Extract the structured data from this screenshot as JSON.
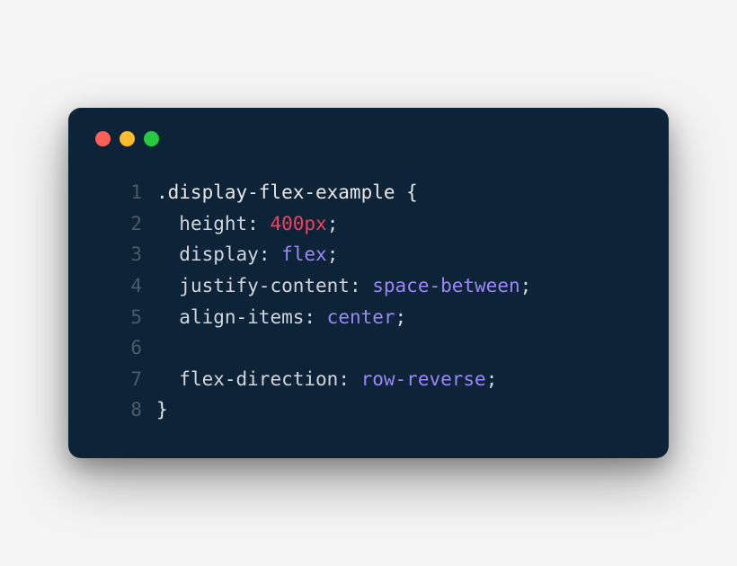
{
  "window": {
    "traffic_lights": [
      "red",
      "yellow",
      "green"
    ]
  },
  "code": {
    "lines": [
      {
        "n": "1",
        "indent": 0,
        "tokens": [
          {
            "t": ".display-flex-example ",
            "c": "tok-selector"
          },
          {
            "t": "{",
            "c": "tok-brace"
          }
        ]
      },
      {
        "n": "2",
        "indent": 2,
        "tokens": [
          {
            "t": "height",
            "c": "tok-prop"
          },
          {
            "t": ": ",
            "c": "tok-punct"
          },
          {
            "t": "400",
            "c": "tok-number"
          },
          {
            "t": "px",
            "c": "tok-unit"
          },
          {
            "t": ";",
            "c": "tok-punct"
          }
        ]
      },
      {
        "n": "3",
        "indent": 2,
        "tokens": [
          {
            "t": "display",
            "c": "tok-prop"
          },
          {
            "t": ": ",
            "c": "tok-punct"
          },
          {
            "t": "flex",
            "c": "tok-value"
          },
          {
            "t": ";",
            "c": "tok-punct"
          }
        ]
      },
      {
        "n": "4",
        "indent": 2,
        "tokens": [
          {
            "t": "justify-content",
            "c": "tok-prop"
          },
          {
            "t": ": ",
            "c": "tok-punct"
          },
          {
            "t": "space-between",
            "c": "tok-value"
          },
          {
            "t": ";",
            "c": "tok-punct"
          }
        ]
      },
      {
        "n": "5",
        "indent": 2,
        "tokens": [
          {
            "t": "align-items",
            "c": "tok-prop"
          },
          {
            "t": ": ",
            "c": "tok-punct"
          },
          {
            "t": "center",
            "c": "tok-value"
          },
          {
            "t": ";",
            "c": "tok-punct"
          }
        ]
      },
      {
        "n": "6",
        "indent": 0,
        "tokens": []
      },
      {
        "n": "7",
        "indent": 2,
        "tokens": [
          {
            "t": "flex-direction",
            "c": "tok-prop"
          },
          {
            "t": ": ",
            "c": "tok-punct"
          },
          {
            "t": "row-reverse",
            "c": "tok-value"
          },
          {
            "t": ";",
            "c": "tok-punct"
          }
        ]
      },
      {
        "n": "8",
        "indent": 0,
        "tokens": [
          {
            "t": "}",
            "c": "tok-brace"
          }
        ]
      }
    ]
  }
}
